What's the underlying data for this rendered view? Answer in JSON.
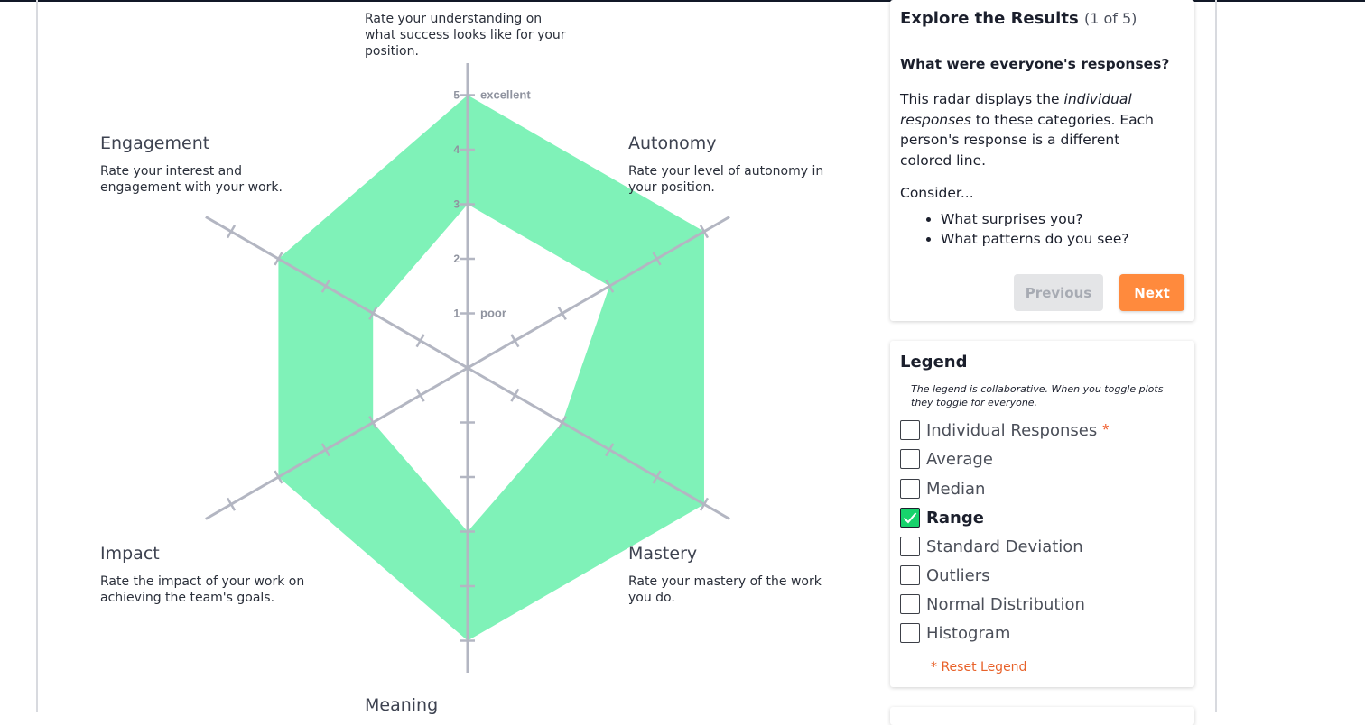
{
  "radar": {
    "scale": {
      "max": 5,
      "ticks": [
        "1",
        "2",
        "3",
        "4",
        "5"
      ],
      "high_label": "excellent",
      "low_label": "poor"
    },
    "categories": [
      {
        "title": "",
        "description": "Rate your understanding on what success looks like for your position."
      },
      {
        "title": "Autonomy",
        "description": "Rate your level of autonomy in your position."
      },
      {
        "title": "Mastery",
        "description": "Rate your mastery of the work you do."
      },
      {
        "title": "Meaning",
        "description": ""
      },
      {
        "title": "Impact",
        "description": "Rate the impact of your work on achieving the team's goals."
      },
      {
        "title": "Engagement",
        "description": "Rate your interest and engagement with your work."
      }
    ],
    "range": {
      "min": [
        3,
        3,
        2,
        3,
        2,
        2
      ],
      "max": [
        5,
        5,
        5,
        5,
        4,
        4
      ]
    },
    "colors": {
      "range_fill": "#7ff2b8",
      "axis": "#b3b6c2",
      "axis_label": "#8f939f"
    }
  },
  "explore": {
    "title": "Explore the Results",
    "count": "(1 of 5)",
    "question": "What were everyone's responses?",
    "para_1": "This radar displays the ",
    "para_em": "individual responses",
    "para_2": " to these categories. Each person's response is a different colored line.",
    "consider": "Consider...",
    "bullets": [
      "What surprises you?",
      "What patterns do you see?"
    ],
    "previous_label": "Previous",
    "next_label": "Next"
  },
  "legend": {
    "title": "Legend",
    "note": "The legend is collaborative. When you toggle plots they toggle for everyone.",
    "items": [
      {
        "label": "Individual Responses",
        "checked": false,
        "star": "*"
      },
      {
        "label": "Average",
        "checked": false
      },
      {
        "label": "Median",
        "checked": false
      },
      {
        "label": "Range",
        "checked": true
      },
      {
        "label": "Standard Deviation",
        "checked": false
      },
      {
        "label": "Outliers",
        "checked": false
      },
      {
        "label": "Normal Distribution",
        "checked": false
      },
      {
        "label": "Histogram",
        "checked": false
      }
    ],
    "reset_label": "* Reset Legend",
    "colors": {
      "checked": "#17d36c",
      "accent": "#f05a28"
    }
  }
}
